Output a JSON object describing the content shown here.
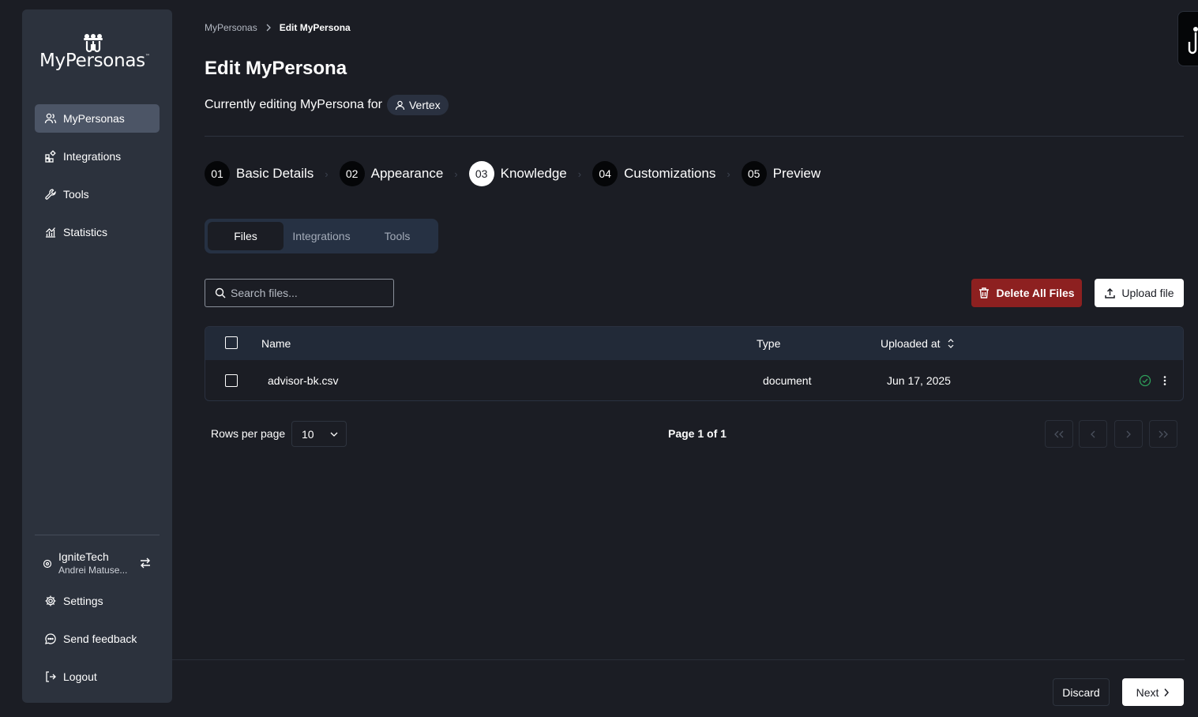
{
  "brand": {
    "name": "MyPersonas",
    "tm": "™",
    "accent": "#f5a623"
  },
  "sidebar": {
    "items": [
      {
        "label": "MyPersonas",
        "icon": "users-icon",
        "active": true
      },
      {
        "label": "Integrations",
        "icon": "integrations-icon"
      },
      {
        "label": "Tools",
        "icon": "wrench-icon"
      },
      {
        "label": "Statistics",
        "icon": "chart-icon"
      }
    ],
    "org": {
      "name": "IgniteTech",
      "user": "Andrei Matuse..."
    },
    "footer_items": [
      {
        "label": "Settings",
        "icon": "gear-icon"
      },
      {
        "label": "Send feedback",
        "icon": "message-icon"
      },
      {
        "label": "Logout",
        "icon": "logout-icon"
      }
    ]
  },
  "breadcrumb": {
    "root": "MyPersonas",
    "current": "Edit MyPersona"
  },
  "header": {
    "title": "Edit MyPersona",
    "subtitle": "Currently editing MyPersona for",
    "persona": "Vertex"
  },
  "steps": [
    {
      "num": "01",
      "label": "Basic Details"
    },
    {
      "num": "02",
      "label": "Appearance"
    },
    {
      "num": "03",
      "label": "Knowledge",
      "active": true
    },
    {
      "num": "04",
      "label": "Customizations"
    },
    {
      "num": "05",
      "label": "Preview"
    }
  ],
  "tabs": [
    "Files",
    "Integrations",
    "Tools"
  ],
  "active_tab": "Files",
  "search": {
    "placeholder": "Search files..."
  },
  "actions": {
    "delete_all": "Delete All Files",
    "upload": "Upload file"
  },
  "table": {
    "columns": {
      "name": "Name",
      "type": "Type",
      "uploaded": "Uploaded at"
    },
    "rows": [
      {
        "name": "advisor-bk.csv",
        "type": "document",
        "uploaded": "Jun 17, 2025",
        "status": "processed"
      }
    ]
  },
  "pagination": {
    "rows_label": "Rows per page",
    "rows_value": "10",
    "page_info": "Page 1 of 1"
  },
  "footer": {
    "discard": "Discard",
    "next": "Next"
  },
  "colors": {
    "danger": "#8d2020",
    "success": "#2e9e5a",
    "background": "#1b1d24",
    "sidebar": "#2c323d"
  }
}
